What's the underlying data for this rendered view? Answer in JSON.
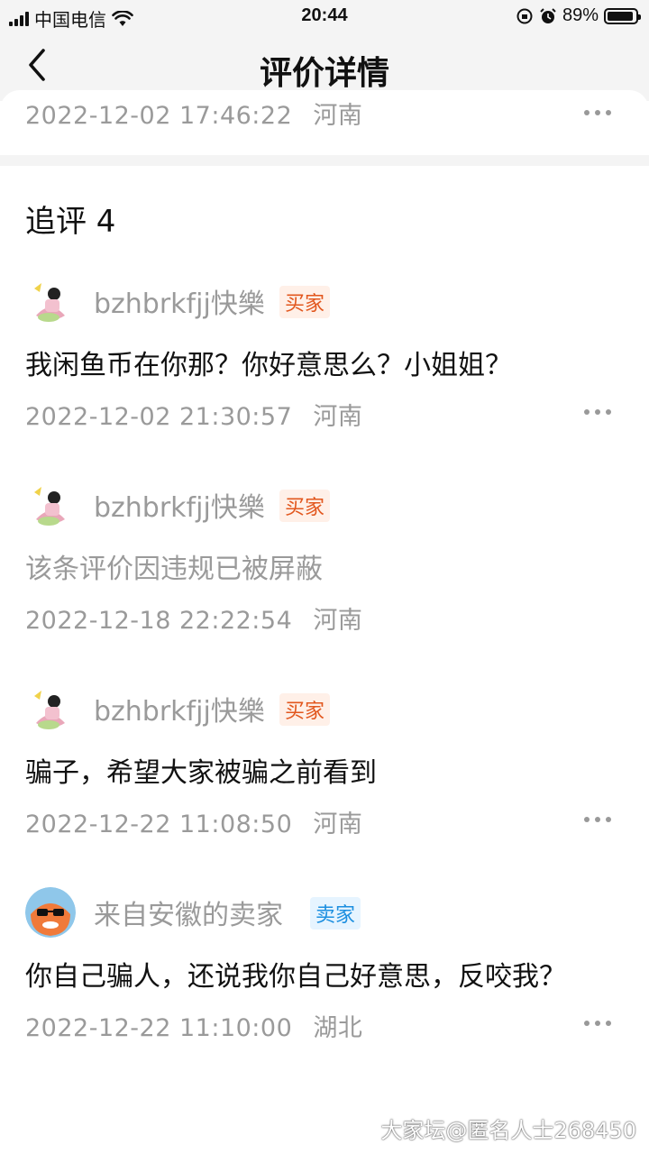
{
  "status_bar": {
    "carrier": "中国电信",
    "time": "20:44",
    "battery": "89%"
  },
  "nav": {
    "title": "评价详情"
  },
  "previous_comment": {
    "time": "2022-12-02 17:46:22",
    "location": "河南"
  },
  "section": {
    "title": "追评 4"
  },
  "replies": [
    {
      "username": "bzhbrkfjj快樂",
      "role": "买家",
      "content": "我闲鱼币在你那？你好意思么？小姐姐？",
      "time": "2022-12-02 21:30:57",
      "location": "河南"
    },
    {
      "username": "bzhbrkfjj快樂",
      "role": "买家",
      "content": "该条评价因违规已被屏蔽",
      "time": "2022-12-18 22:22:54",
      "location": "河南"
    },
    {
      "username": "bzhbrkfjj快樂",
      "role": "买家",
      "content": "骗子，希望大家被骗之前看到",
      "time": "2022-12-22 11:08:50",
      "location": "河南"
    },
    {
      "username": "来自安徽的卖家",
      "role": "卖家",
      "content": "你自己骗人，还说我你自己好意思，反咬我？",
      "time": "2022-12-22 11:10:00",
      "location": "湖北"
    }
  ],
  "watermark": "大家坛@匿名人士268450",
  "colors": {
    "buyer_badge_text": "#e2571e",
    "buyer_badge_bg": "#fff0e8",
    "seller_badge_text": "#1c8fe0",
    "seller_badge_bg": "#e6f4ff",
    "muted_text": "#9a9a9a"
  }
}
